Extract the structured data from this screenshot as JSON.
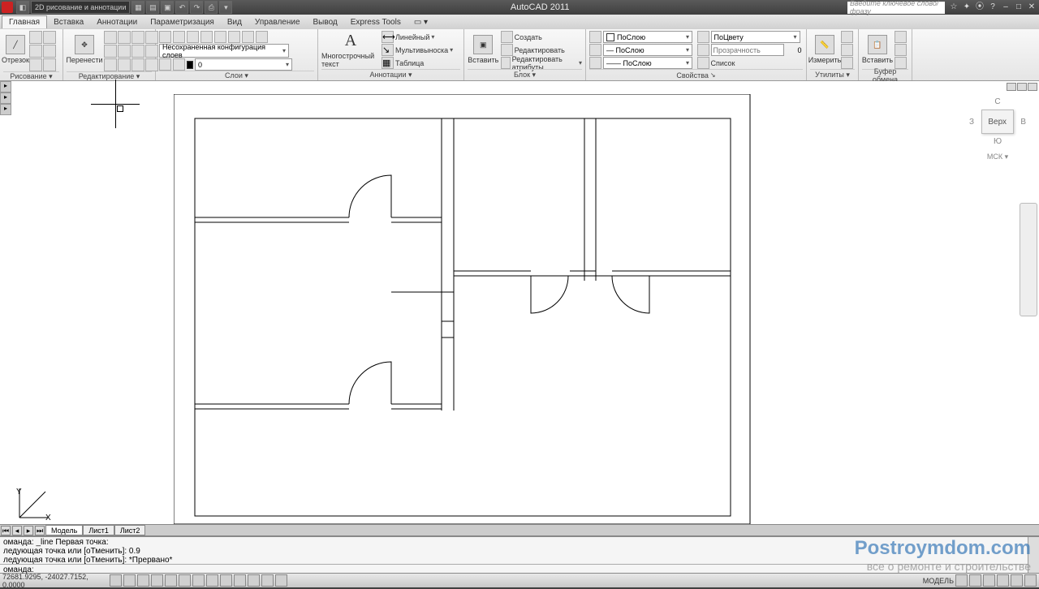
{
  "app": {
    "title": "AutoCAD 2011",
    "quickaccess_file": "2D рисование и аннотации",
    "search_placeholder": "Введите ключевое слово/фразу"
  },
  "menu": {
    "tabs": [
      "Главная",
      "Вставка",
      "Аннотации",
      "Параметризация",
      "Вид",
      "Управление",
      "Вывод",
      "Express Tools"
    ]
  },
  "ribbon": {
    "draw": {
      "label": "Отрезок",
      "panel": "Рисование ▾"
    },
    "modify": {
      "label": "Перенести",
      "panel": "Редактирование ▾"
    },
    "layers": {
      "combo": "Несохраненная конфигурация слоев",
      "color": "0",
      "panel": "Слои ▾"
    },
    "annot": {
      "mtext": "Многострочный текст",
      "linear": "Линейный",
      "mleader": "Мультивыноска",
      "annolabel": "▾",
      "table": "Таблица",
      "panel": "Аннотации ▾"
    },
    "block": {
      "insert": "Вставить",
      "create": "Создать",
      "edit": "Редактировать",
      "editattr": "Редактировать атрибуты",
      "panel": "Блок ▾"
    },
    "props": {
      "bylayer": "ПоСлою",
      "bycolor": "ПоЦвету",
      "linetype": "ПоСлою",
      "lineweight": "ПоСлою",
      "transp_label": "Прозрачность",
      "transp_val": "0",
      "list": "Список",
      "panel": "Свойства"
    },
    "utils": {
      "measure": "Измерить",
      "paste": "Вставить",
      "panel": "Утилиты ▾",
      "clip": "Буфер обмена"
    }
  },
  "modeltabs": {
    "model": "Модель",
    "l1": "Лист1",
    "l2": "Лист2"
  },
  "cmd": {
    "h1": "оманда: _line Первая точка:",
    "h2": "ледующая точка или [оТменить]: 0.9",
    "h3": "ледующая точка или [оТменить]: *Прервано*",
    "prompt": "оманда:"
  },
  "status": {
    "coords": "72681.9295, -24027.7152, 0.0000",
    "right": "МОДЕЛЬ"
  },
  "nav": {
    "n": "С",
    "s": "Ю",
    "e": "В",
    "w": "З",
    "top": "Верх",
    "wcs": "МСК ▾"
  },
  "watermark": {
    "line1": "Postroymdom.com",
    "line2": "все о ремонте и строительстве"
  }
}
